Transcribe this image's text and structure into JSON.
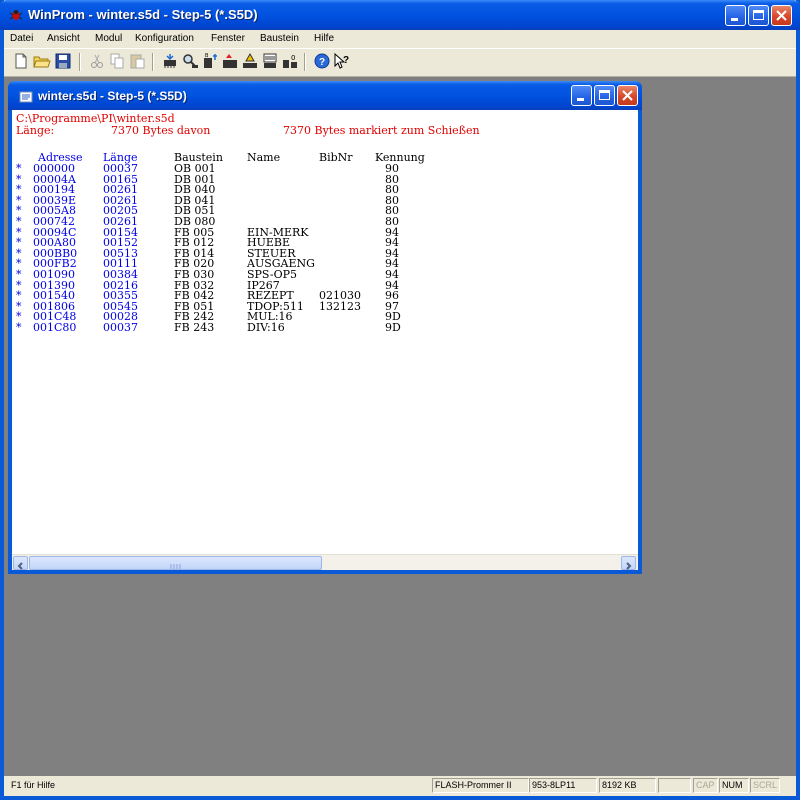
{
  "window": {
    "title": "WinProm - winter.s5d - Step-5 (*.S5D)"
  },
  "menu": [
    "Datei",
    "Ansicht",
    "Modul",
    "Konfiguration",
    "Fenster",
    "Baustein",
    "Hilfe"
  ],
  "toolbar_icons": [
    "new-file-icon",
    "open-folder-icon",
    "save-icon",
    "cut-icon",
    "copy-icon",
    "paste-icon",
    "eprom-read-icon",
    "inspect-icon",
    "blank-check-icon",
    "program-icon",
    "compare-icon",
    "erase-icon",
    "module-icon",
    "help-icon",
    "context-help-icon"
  ],
  "child": {
    "title": "winter.s5d - Step-5 (*.S5D)",
    "path": "C:\\Programme\\PI\\winter.s5d",
    "summary_label": "Länge:",
    "summary_bytes": "7370 Bytes davon",
    "summary_marked": "7370 Bytes markiert zum Schießen",
    "columns": {
      "adresse": "Adresse",
      "laenge": "Länge",
      "baustein": "Baustein",
      "name": "Name",
      "bibnr": "BibNr",
      "kennung": "Kennung"
    },
    "rows": [
      {
        "mark": "*",
        "adresse": "000000",
        "laenge": "00037",
        "baustein": "OB 001",
        "name": "",
        "bibnr": "",
        "kennung": "90"
      },
      {
        "mark": "*",
        "adresse": "00004A",
        "laenge": "00165",
        "baustein": "DB 001",
        "name": "",
        "bibnr": "",
        "kennung": "80"
      },
      {
        "mark": "*",
        "adresse": "000194",
        "laenge": "00261",
        "baustein": "DB 040",
        "name": "",
        "bibnr": "",
        "kennung": "80"
      },
      {
        "mark": "*",
        "adresse": "00039E",
        "laenge": "00261",
        "baustein": "DB 041",
        "name": "",
        "bibnr": "",
        "kennung": "80"
      },
      {
        "mark": "*",
        "adresse": "0005A8",
        "laenge": "00205",
        "baustein": "DB 051",
        "name": "",
        "bibnr": "",
        "kennung": "80"
      },
      {
        "mark": "*",
        "adresse": "000742",
        "laenge": "00261",
        "baustein": "DB 080",
        "name": "",
        "bibnr": "",
        "kennung": "80"
      },
      {
        "mark": "*",
        "adresse": "00094C",
        "laenge": "00154",
        "baustein": "FB 005",
        "name": "EIN-MERK",
        "bibnr": "",
        "kennung": "94"
      },
      {
        "mark": "*",
        "adresse": "000A80",
        "laenge": "00152",
        "baustein": "FB 012",
        "name": "HUEBE",
        "bibnr": "",
        "kennung": "94"
      },
      {
        "mark": "*",
        "adresse": "000BB0",
        "laenge": "00513",
        "baustein": "FB 014",
        "name": "STEUER",
        "bibnr": "",
        "kennung": "94"
      },
      {
        "mark": "*",
        "adresse": "000FB2",
        "laenge": "00111",
        "baustein": "FB 020",
        "name": "AUSGAENG",
        "bibnr": "",
        "kennung": "94"
      },
      {
        "mark": "*",
        "adresse": "001090",
        "laenge": "00384",
        "baustein": "FB 030",
        "name": "SPS-OP5",
        "bibnr": "",
        "kennung": "94"
      },
      {
        "mark": "*",
        "adresse": "001390",
        "laenge": "00216",
        "baustein": "FB 032",
        "name": "IP267",
        "bibnr": "",
        "kennung": "94"
      },
      {
        "mark": "*",
        "adresse": "001540",
        "laenge": "00355",
        "baustein": "FB 042",
        "name": "REZEPT",
        "bibnr": "021030",
        "kennung": "96"
      },
      {
        "mark": "*",
        "adresse": "001806",
        "laenge": "00545",
        "baustein": "FB 051",
        "name": "TDOP:511",
        "bibnr": "132123",
        "kennung": "97"
      },
      {
        "mark": "*",
        "adresse": "001C48",
        "laenge": "00028",
        "baustein": "FB 242",
        "name": "MUL:16",
        "bibnr": "",
        "kennung": "9D"
      },
      {
        "mark": "*",
        "adresse": "001C80",
        "laenge": "00037",
        "baustein": "FB 243",
        "name": "DIV:16",
        "bibnr": "",
        "kennung": "9D"
      }
    ]
  },
  "status": {
    "help": "F1 für Hilfe",
    "device": "FLASH-Prommer II",
    "chip": "953-8LP11",
    "size": "8192 KB",
    "cap": "CAP",
    "num": "NUM",
    "scrl": "SCRL"
  },
  "colors": {
    "title_blue": "#0054e3",
    "mdi_background": "#808080",
    "header_red": "#e00000",
    "address_blue": "#0000e8"
  }
}
